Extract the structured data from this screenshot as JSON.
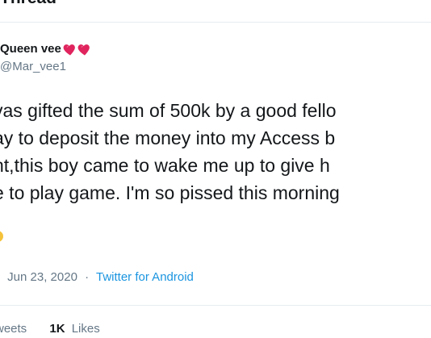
{
  "header": {
    "title": "Thread"
  },
  "author": {
    "display_name": "Queen vee",
    "emoji": [
      "heart-icon",
      "heart-icon"
    ],
    "username": "@Mar_vee1"
  },
  "tweet": {
    "lines": [
      "vas gifted the sum of 500k by a good fello",
      "ay to deposit the money into my Access b",
      "nt,this boy came to wake me up to give h",
      "e to play game. I'm so pissed this morning"
    ]
  },
  "meta": {
    "prefix": "·",
    "date": "Jun 23, 2020",
    "separator": "·",
    "source": "Twitter for Android"
  },
  "stats": {
    "retweets_label": "weets",
    "likes_count": "1K",
    "likes_label": "Likes"
  },
  "colors": {
    "text": "#14171a",
    "muted": "#657786",
    "link": "#1b95e0",
    "divider": "#e6ecf0",
    "heart": "#e0245e"
  }
}
